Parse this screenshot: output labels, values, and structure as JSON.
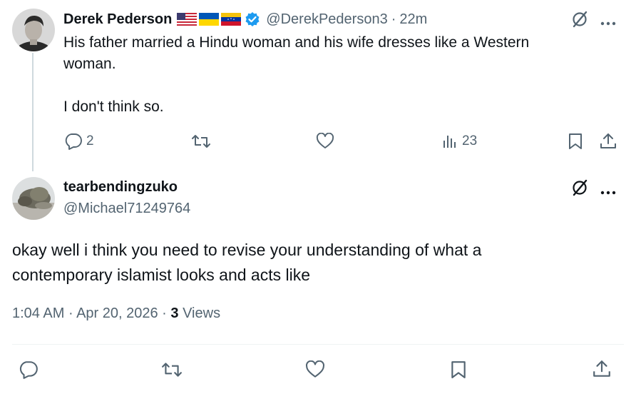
{
  "parent_tweet": {
    "author_name": "Derek Pederson",
    "flags": [
      "us-flag",
      "ukraine-flag",
      "venezuela-flag"
    ],
    "handle": "@DerekPederson3",
    "separator": "·",
    "time": "22m",
    "text_line1": "His father married a Hindu woman and his wife dresses like a Western",
    "text_line2": "woman.",
    "text_line3": "I don't think so.",
    "reply_count": "2",
    "views_count": "23"
  },
  "reply_tweet": {
    "author_name": "tearbendingzuko",
    "handle": "@Michael71249764",
    "text_line1": "okay well i think you need to revise your understanding of what a",
    "text_line2": "contemporary islamist looks and acts like",
    "time": "1:04 AM",
    "date": "Apr 20, 2026",
    "views_number": "3",
    "views_label": "Views"
  },
  "colors": {
    "text": "#0f1419",
    "muted": "#536471",
    "verified": "#1d9bf0",
    "thread_line": "#cfd9de"
  }
}
